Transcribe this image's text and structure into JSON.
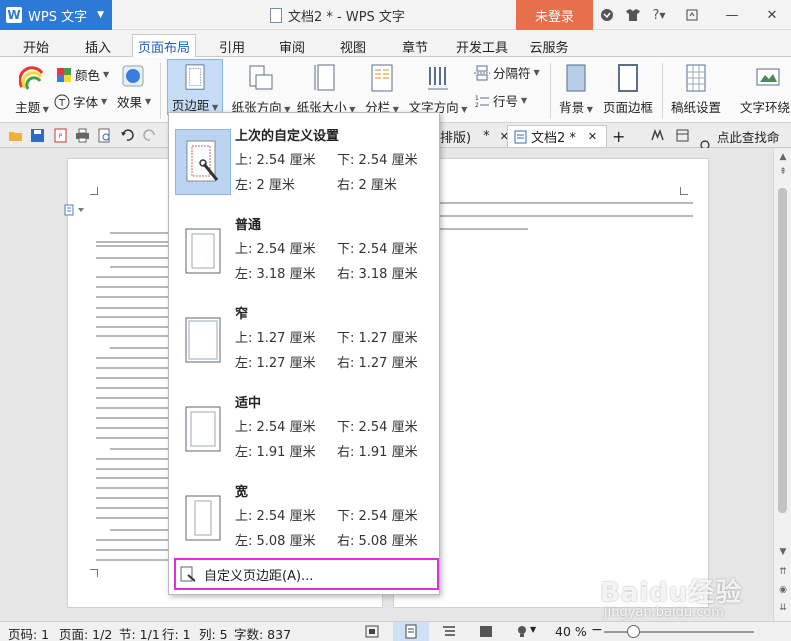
{
  "titlebar": {
    "app_name": "WPS 文字",
    "doc_title": "文档2 * - WPS 文字",
    "login_label": "未登录",
    "help_label": "?"
  },
  "menu": {
    "tabs": [
      "开始",
      "插入",
      "页面布局",
      "引用",
      "审阅",
      "视图",
      "章节",
      "开发工具",
      "云服务"
    ],
    "active": "页面布局"
  },
  "ribbon": {
    "theme": "主题",
    "color": "颜色",
    "font": "字体",
    "effect": "效果",
    "margins": "页边距",
    "orientation": "纸张方向",
    "size": "纸张大小",
    "columns": "分栏",
    "text_direction": "文字方向",
    "separator": "分隔符",
    "line_number": "行号",
    "background": "背景",
    "page_border": "页面边框",
    "manuscript": "稿纸设置",
    "wrap": "文字环绕"
  },
  "doc_tabs": {
    "tab1": "排版)",
    "tab1_marker": "*",
    "tab2": "文档2 *",
    "search_cmd": "点此查找命令"
  },
  "margins_menu": {
    "presets": [
      {
        "name": "上次的自定义设置",
        "top": "上: 2.54 厘米",
        "bottom": "下: 2.54 厘米",
        "left": "左: 2 厘米",
        "right": "右: 2 厘米"
      },
      {
        "name": "普通",
        "top": "上: 2.54 厘米",
        "bottom": "下: 2.54 厘米",
        "left": "左: 3.18 厘米",
        "right": "右: 3.18 厘米"
      },
      {
        "name": "窄",
        "top": "上: 1.27 厘米",
        "bottom": "下: 1.27 厘米",
        "left": "左: 1.27 厘米",
        "right": "右: 1.27 厘米"
      },
      {
        "name": "适中",
        "top": "上: 2.54 厘米",
        "bottom": "下: 2.54 厘米",
        "left": "左: 1.91 厘米",
        "right": "右: 1.91 厘米"
      },
      {
        "name": "宽",
        "top": "上: 2.54 厘米",
        "bottom": "下: 2.54 厘米",
        "left": "左: 5.08 厘米",
        "right": "右: 5.08 厘米"
      }
    ],
    "custom_label": "自定义页边距(A)..."
  },
  "statusbar": {
    "page_num": "页码: 1",
    "pages": "页面: 1/2",
    "section": "节: 1/1",
    "row": "行: 1",
    "col": "列: 5",
    "word_count": "字数: 837",
    "zoom": "40 %"
  },
  "watermark": {
    "line1": "Baidu经验",
    "line2": "jingyan.baidu.com"
  },
  "colors": {
    "accent": "#2d7ad6",
    "login": "#e86f4b",
    "highlight": "#e12ee1"
  }
}
